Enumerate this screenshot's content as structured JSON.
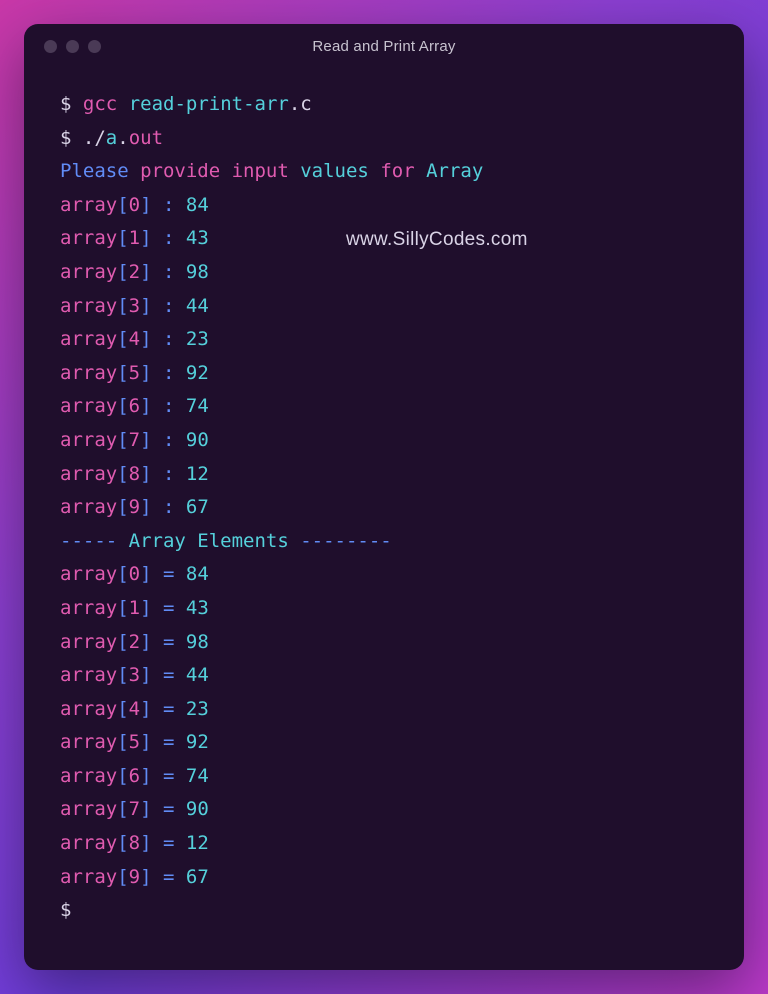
{
  "window": {
    "title": "Read and Print Array"
  },
  "watermark": "www.SillyCodes.com",
  "prompt": "$",
  "cmd1": {
    "bin": "gcc",
    "file_base": "read-print-arr",
    "file_ext": ".c"
  },
  "cmd2": {
    "dotslash": "./",
    "a": "a",
    "dot": ".",
    "out": "out"
  },
  "msg": {
    "please": "Please ",
    "provide": "provide ",
    "input": "input ",
    "values": "values ",
    "for": "for ",
    "array": "Array"
  },
  "array_word": "array",
  "colon_sep": " : ",
  "eq_sep": " = ",
  "divider": {
    "pre": "----- ",
    "label": "Array Elements",
    "post": " --------"
  },
  "inputs": [
    {
      "idx": "0",
      "val": "84"
    },
    {
      "idx": "1",
      "val": "43"
    },
    {
      "idx": "2",
      "val": "98"
    },
    {
      "idx": "3",
      "val": "44"
    },
    {
      "idx": "4",
      "val": "23"
    },
    {
      "idx": "5",
      "val": "92"
    },
    {
      "idx": "6",
      "val": "74"
    },
    {
      "idx": "7",
      "val": "90"
    },
    {
      "idx": "8",
      "val": "12"
    },
    {
      "idx": "9",
      "val": "67"
    }
  ],
  "outputs": [
    {
      "idx": "0",
      "val": "84"
    },
    {
      "idx": "1",
      "val": "43"
    },
    {
      "idx": "2",
      "val": "98"
    },
    {
      "idx": "3",
      "val": "44"
    },
    {
      "idx": "4",
      "val": "23"
    },
    {
      "idx": "5",
      "val": "92"
    },
    {
      "idx": "6",
      "val": "74"
    },
    {
      "idx": "7",
      "val": "90"
    },
    {
      "idx": "8",
      "val": "12"
    },
    {
      "idx": "9",
      "val": "67"
    }
  ]
}
